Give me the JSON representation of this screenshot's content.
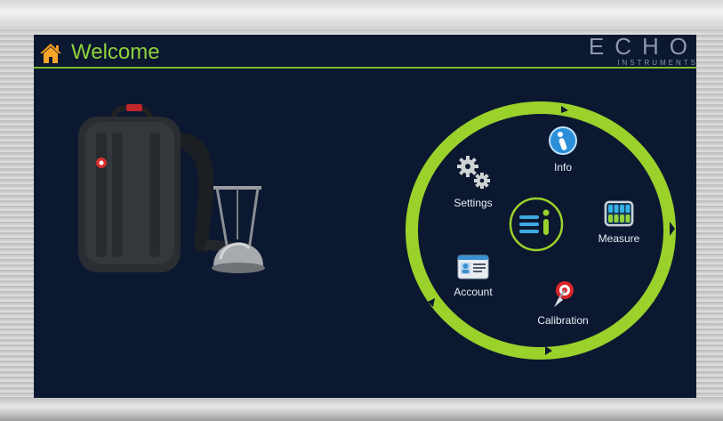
{
  "header": {
    "title": "Welcome",
    "home_icon": "home-icon",
    "brand_name": "ECHO",
    "brand_sub": "INSTRUMENTS"
  },
  "colors": {
    "screen_bg": "#0b1830",
    "accent_green": "#8fd23a",
    "ring_green": "#9bd12b",
    "text_light": "#e8eef6"
  },
  "menu": {
    "items": [
      {
        "label": "Info",
        "icon": "info-icon"
      },
      {
        "label": "Settings",
        "icon": "gears-icon"
      },
      {
        "label": "Measure",
        "icon": "grid-meter-icon"
      },
      {
        "label": "Account",
        "icon": "id-card-icon"
      },
      {
        "label": "Calibration",
        "icon": "satellite-dish-icon"
      }
    ],
    "center_icon": "echo-logo-icon"
  },
  "device_image": "backpack-with-probe-image"
}
